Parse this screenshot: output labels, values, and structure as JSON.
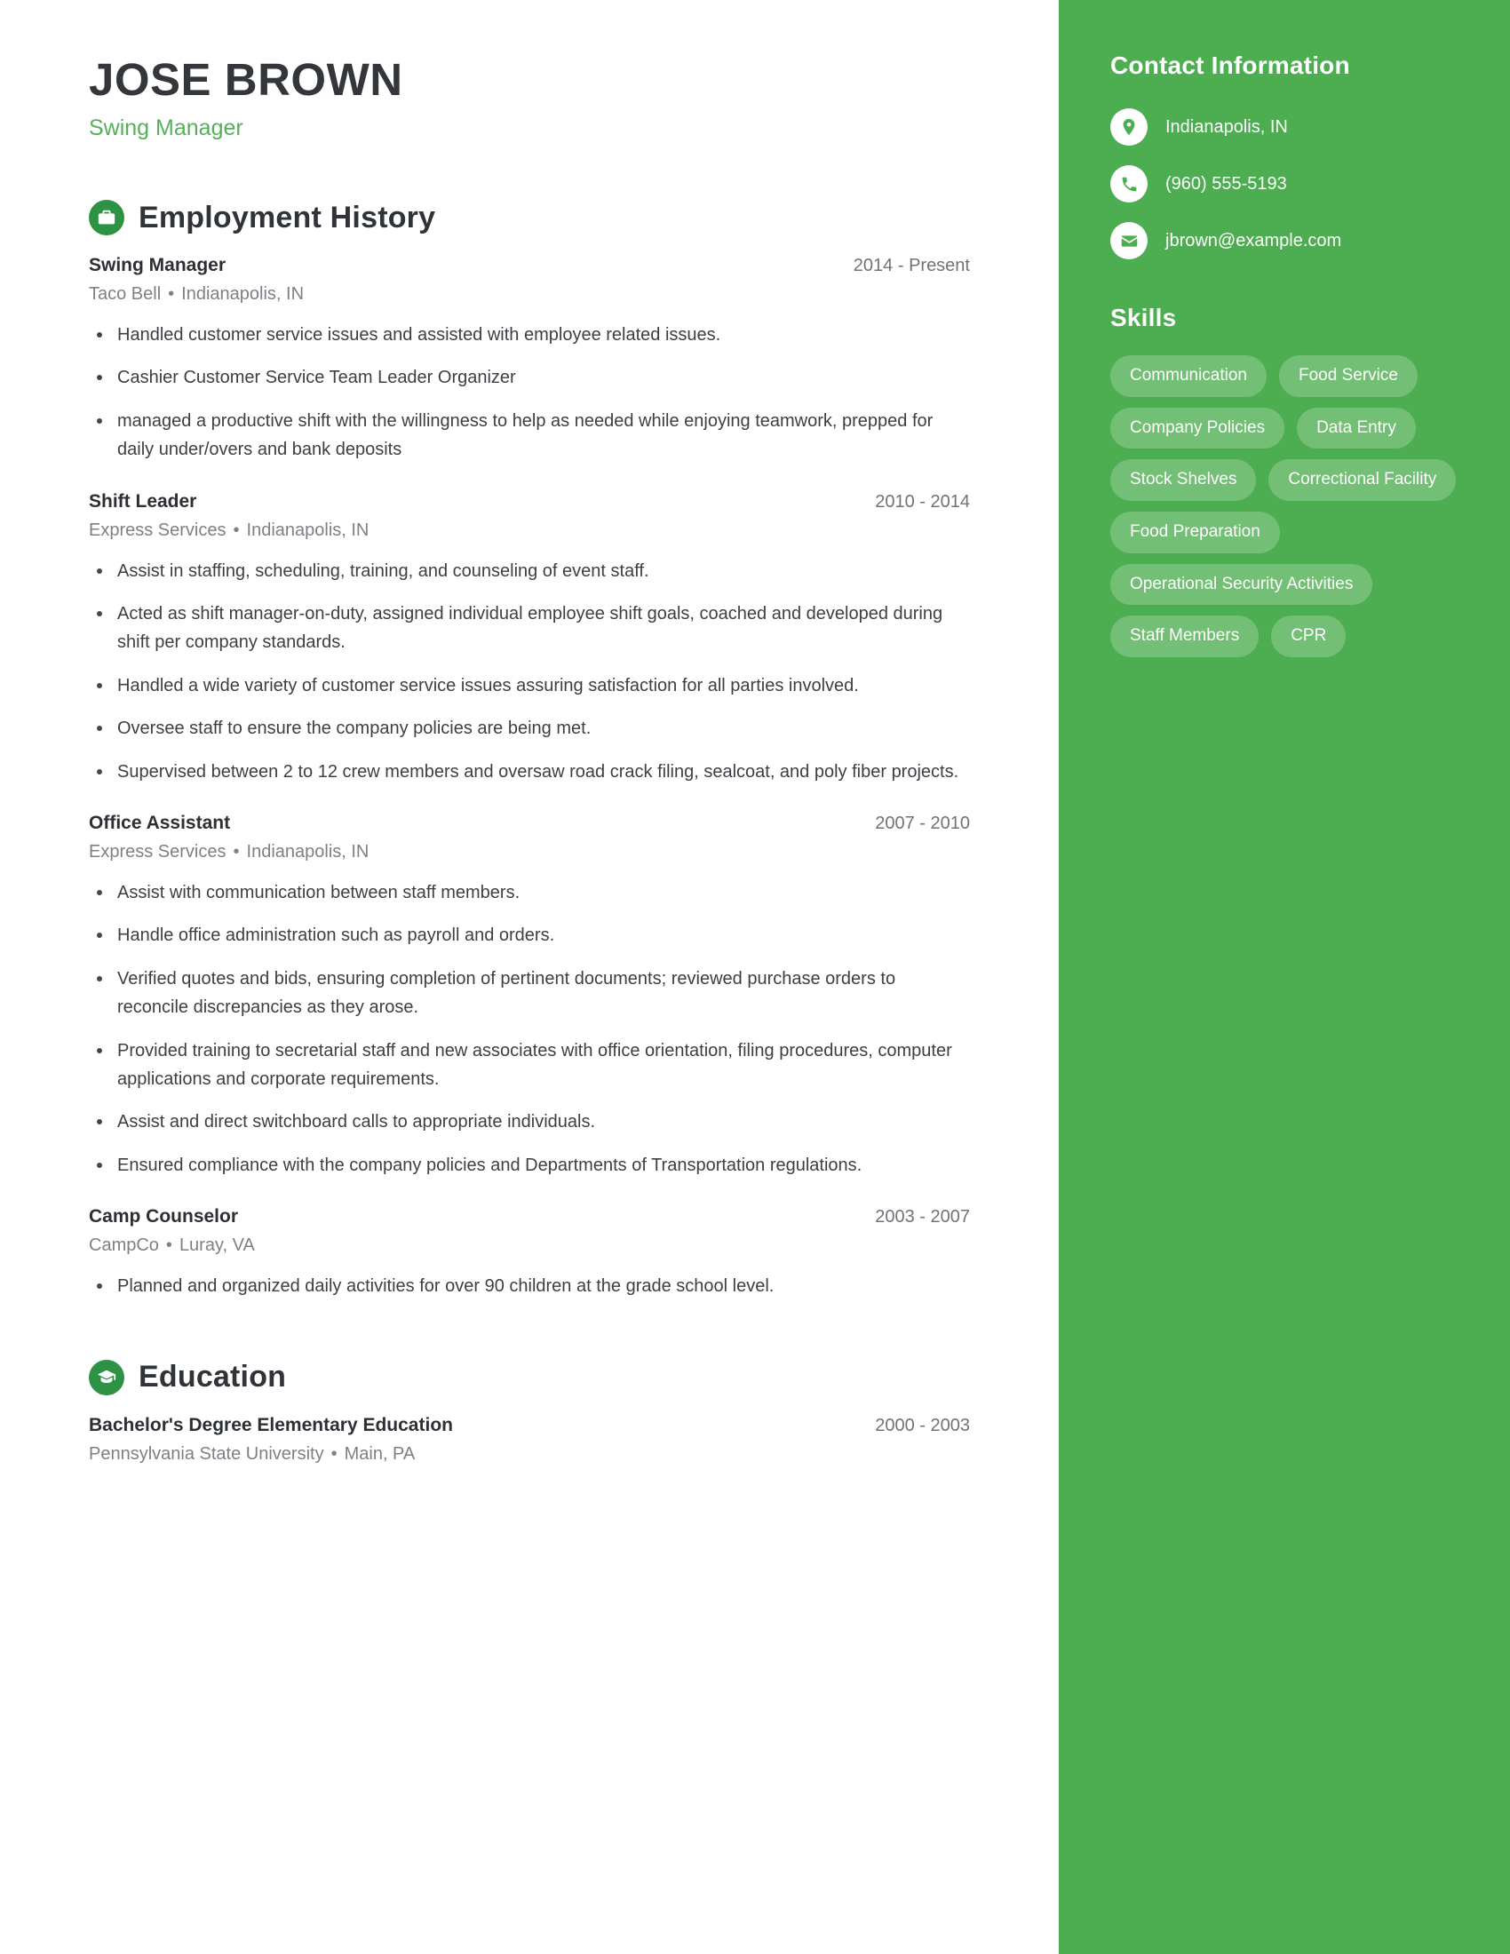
{
  "colors": {
    "sidebar_green": "#4cae50",
    "accent_green": "#55b158",
    "icon_circle_green": "#2e9245",
    "heading_dark": "#303337",
    "body_text": "#3c3f43",
    "muted_text": "#7d8185"
  },
  "header": {
    "name": "JOSE BROWN",
    "title": "Swing Manager"
  },
  "sections": {
    "employment": {
      "heading": "Employment History",
      "icon": "briefcase-icon",
      "entries": [
        {
          "role": "Swing Manager",
          "date": "2014 - Present",
          "company": "Taco Bell",
          "separator": "•",
          "location": "Indianapolis, IN",
          "bullets": [
            "Handled customer service issues and assisted with employee related issues.",
            "Cashier Customer Service Team Leader Organizer",
            "managed a productive shift with the willingness to help as needed while enjoying teamwork, prepped for daily under/overs and bank deposits"
          ]
        },
        {
          "role": "Shift Leader",
          "date": "2010 - 2014",
          "company": "Express Services",
          "separator": "•",
          "location": "Indianapolis, IN",
          "bullets": [
            "Assist in staffing, scheduling, training, and counseling of event staff.",
            "Acted as shift manager-on-duty, assigned individual employee shift goals, coached and developed during shift per company standards.",
            "Handled a wide variety of customer service issues assuring satisfaction for all parties involved.",
            "Oversee staff to ensure the company policies are being met.",
            "Supervised between 2 to 12 crew members and oversaw road crack filing, sealcoat, and poly fiber projects."
          ]
        },
        {
          "role": "Office Assistant",
          "date": "2007 - 2010",
          "company": "Express Services",
          "separator": "•",
          "location": "Indianapolis, IN",
          "bullets": [
            "Assist with communication between staff members.",
            "Handle office administration such as payroll and orders.",
            "Verified quotes and bids, ensuring completion of pertinent documents; reviewed purchase orders to reconcile discrepancies as they arose.",
            "Provided training to secretarial staff and new associates with office orientation, filing procedures, computer applications and corporate requirements.",
            "Assist and direct switchboard calls to appropriate individuals.",
            "Ensured compliance with the company policies and Departments of Transportation regulations."
          ]
        },
        {
          "role": "Camp Counselor",
          "date": "2003 - 2007",
          "company": "CampCo",
          "separator": "•",
          "location": "Luray, VA",
          "bullets": [
            "Planned and organized daily activities for over 90 children at the grade school level."
          ]
        }
      ]
    },
    "education": {
      "heading": "Education",
      "icon": "graduation-cap-icon",
      "entries": [
        {
          "role": "Bachelor's Degree Elementary Education",
          "date": "2000 - 2003",
          "company": "Pennsylvania State University",
          "separator": "•",
          "location": "Main, PA",
          "bullets": []
        }
      ]
    }
  },
  "sidebar": {
    "contact": {
      "heading": "Contact Information",
      "items": [
        {
          "icon": "location-pin-icon",
          "text": "Indianapolis, IN"
        },
        {
          "icon": "phone-icon",
          "text": "(960) 555-5193"
        },
        {
          "icon": "envelope-icon",
          "text": "jbrown@example.com"
        }
      ]
    },
    "skills": {
      "heading": "Skills",
      "items": [
        "Communication",
        "Food Service",
        "Company Policies",
        "Data Entry",
        "Stock Shelves",
        "Correctional Facility",
        "Food Preparation",
        "Operational Security Activities",
        "Staff Members",
        "CPR"
      ]
    }
  }
}
